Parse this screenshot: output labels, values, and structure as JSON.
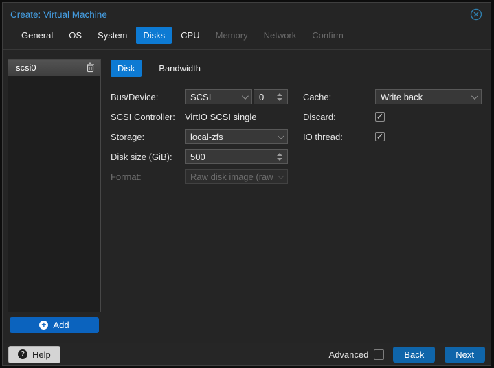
{
  "window": {
    "title": "Create: Virtual Machine"
  },
  "colors": {
    "accent_tab_blue": "#0d7ad3",
    "button_blue": "#0f65aa",
    "add_button_blue": "#0b63be",
    "title_blue": "#459fe4",
    "dialog_bg": "#252525",
    "field_bg": "#383838"
  },
  "wizard_tabs": [
    {
      "label": "General",
      "state": "enabled"
    },
    {
      "label": "OS",
      "state": "enabled"
    },
    {
      "label": "System",
      "state": "enabled"
    },
    {
      "label": "Disks",
      "state": "active"
    },
    {
      "label": "CPU",
      "state": "enabled"
    },
    {
      "label": "Memory",
      "state": "disabled"
    },
    {
      "label": "Network",
      "state": "disabled"
    },
    {
      "label": "Confirm",
      "state": "disabled"
    }
  ],
  "disk_panel": {
    "items": [
      {
        "label": "scsi0",
        "selected": true
      }
    ],
    "add_label": "Add",
    "add_icon": "+"
  },
  "disk_tabs": [
    {
      "label": "Disk",
      "state": "active"
    },
    {
      "label": "Bandwidth",
      "state": "normal"
    }
  ],
  "form": {
    "bus_device": {
      "label": "Bus/Device:",
      "value": "SCSI",
      "number": "0"
    },
    "scsi_controller": {
      "label": "SCSI Controller:",
      "value": "VirtIO SCSI single"
    },
    "storage": {
      "label": "Storage:",
      "value": "local-zfs"
    },
    "disk_size": {
      "label": "Disk size (GiB):",
      "value": "500"
    },
    "format": {
      "label": "Format:",
      "value": "Raw disk image (raw",
      "disabled": true
    },
    "cache": {
      "label": "Cache:",
      "value": "Write back"
    },
    "discard": {
      "label": "Discard:",
      "checked": true
    },
    "io_thread": {
      "label": "IO thread:",
      "checked": true
    }
  },
  "footer": {
    "help": "Help",
    "help_icon": "?",
    "advanced": "Advanced",
    "advanced_checked": false,
    "back": "Back",
    "next": "Next"
  }
}
